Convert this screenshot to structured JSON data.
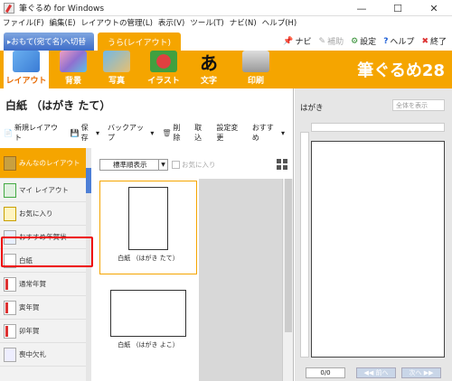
{
  "window": {
    "title": "筆ぐるめ for Windows",
    "minimize": "—",
    "maximize": "☐",
    "close": "✕"
  },
  "menu": [
    "ファイル(F)",
    "編集(E)",
    "レイアウトの管理(L)",
    "表示(V)",
    "ツール(T)",
    "ナビ(N)",
    "ヘルプ(H)"
  ],
  "nav": {
    "omote_tab": "▸おもて(宛て名)へ切替",
    "ura_tab": "うら(レイアウト)",
    "navi": "ナビ",
    "hojo": "補助",
    "settei": "設定",
    "help": "ヘルプ",
    "shuryo": "終了"
  },
  "ribbon": {
    "items": [
      "レイアウト",
      "背景",
      "写真",
      "イラスト",
      "文字",
      "印刷"
    ],
    "logo": "筆ぐるめ28",
    "accent": "#f5a500"
  },
  "document": {
    "title": "白紙 （はがき たて）"
  },
  "toolbar": {
    "new_layout": "新規レイアウト",
    "save": "保存",
    "backup": "バックアップ",
    "delete": "削除",
    "import": "取込",
    "change_settings": "設定変更",
    "recommended": "おすすめ"
  },
  "categories": [
    "みんなのレイアウト",
    "マイ レイアウト",
    "お気に入り",
    "おすすめ年賀状",
    "白紙",
    "通常年賀",
    "寅年賀",
    "卯年賀",
    "喪中欠礼"
  ],
  "view": {
    "sort": "標準順表示",
    "favorites_filter": "お気に入り"
  },
  "thumbnails": [
    {
      "label": "白紙 （はがき たて）"
    },
    {
      "label": "白紙 （はがき よこ）"
    }
  ],
  "preview": {
    "title": "はがき",
    "zoom": "全体を表示",
    "page": "0/0",
    "prev": "◀◀ 前へ",
    "next": "次へ ▶▶"
  }
}
